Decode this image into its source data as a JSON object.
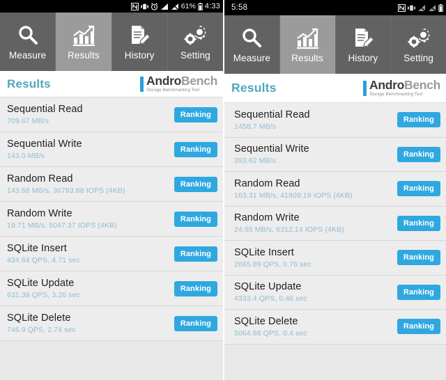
{
  "left": {
    "statusbar": {
      "clock": "4:33",
      "battery_pct": "61%",
      "icons": [
        "nfc-icon",
        "vibrate-icon",
        "alarm-icon",
        "signal-icon",
        "signal-off-icon",
        "battery-icon"
      ]
    },
    "tabs": [
      {
        "label": "Measure",
        "icon": "magnifier-icon",
        "active": false
      },
      {
        "label": "Results",
        "icon": "bar-chart-icon",
        "active": true
      },
      {
        "label": "History",
        "icon": "document-pen-icon",
        "active": false
      },
      {
        "label": "Setting",
        "icon": "gears-icon",
        "active": false
      }
    ],
    "header": {
      "title": "Results",
      "logo_main_1": "Andro",
      "logo_main_2": "Bench",
      "logo_sub": "Storage Benchmarking Tool"
    },
    "rows": [
      {
        "name": "Sequential Read",
        "value": "709.67 MB/s",
        "button": "Ranking"
      },
      {
        "name": "Sequential Write",
        "value": "143.0 MB/s",
        "button": "Ranking"
      },
      {
        "name": "Random Read",
        "value": "143.68 MB/s, 36783.88 IOPS (4KB)",
        "button": "Ranking"
      },
      {
        "name": "Random Write",
        "value": "19.71 MB/s, 5047.37 IOPS (4KB)",
        "button": "Ranking"
      },
      {
        "name": "SQLite Insert",
        "value": "434.64 QPS, 4.71 sec",
        "button": "Ranking"
      },
      {
        "name": "SQLite Update",
        "value": "631.38 QPS, 3.26 sec",
        "button": "Ranking"
      },
      {
        "name": "SQLite Delete",
        "value": "746.9 QPS, 2.74 sec",
        "button": "Ranking"
      }
    ]
  },
  "right": {
    "statusbar": {
      "clock": "5:58",
      "battery_pct": "",
      "icons": [
        "nfc-icon",
        "vibrate-icon",
        "signal-off-icon",
        "signal-off-icon",
        "battery-icon"
      ]
    },
    "tabs": [
      {
        "label": "Measure",
        "icon": "magnifier-icon",
        "active": false
      },
      {
        "label": "Results",
        "icon": "bar-chart-icon",
        "active": true
      },
      {
        "label": "History",
        "icon": "document-pen-icon",
        "active": false
      },
      {
        "label": "Setting",
        "icon": "gears-icon",
        "active": false
      }
    ],
    "header": {
      "title": "Results",
      "logo_main_1": "Andro",
      "logo_main_2": "Bench",
      "logo_sub": "Storage Benchmarking Tool"
    },
    "rows": [
      {
        "name": "Sequential Read",
        "value": "1458.7 MB/s",
        "button": "Ranking"
      },
      {
        "name": "Sequential Write",
        "value": "393.62 MB/s",
        "button": "Ranking"
      },
      {
        "name": "Random Read",
        "value": "163.31 MB/s, 41809.19 IOPS (4KB)",
        "button": "Ranking"
      },
      {
        "name": "Random Write",
        "value": "24.65 MB/s, 6312.14 IOPS (4KB)",
        "button": "Ranking"
      },
      {
        "name": "SQLite Insert",
        "value": "2665.89 QPS, 0.76 sec",
        "button": "Ranking"
      },
      {
        "name": "SQLite Update",
        "value": "4333.4 QPS, 0.46 sec",
        "button": "Ranking"
      },
      {
        "name": "SQLite Delete",
        "value": "5064.88 QPS, 0.4 sec",
        "button": "Ranking"
      }
    ]
  },
  "colors": {
    "accent_blue": "#2fa8e0",
    "title_teal": "#4fa8bb",
    "value_blue": "#8fbcd4",
    "tab_bg": "#626262",
    "tab_active_bg": "#9b9b9b",
    "row_bg": "#ededed"
  }
}
